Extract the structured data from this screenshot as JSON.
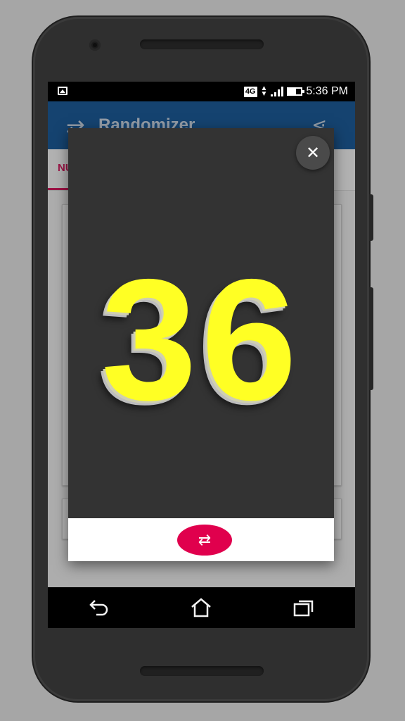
{
  "status_bar": {
    "network": "4G",
    "time": "5:36 PM"
  },
  "app_bar": {
    "title": "Randomizer"
  },
  "tabs": [
    {
      "label": "NU"
    }
  ],
  "dialog": {
    "result": "36",
    "number_color": "#ffff24",
    "background_color": "#333333",
    "close_icon": "close-icon",
    "shuffle_icon": "repeat-icon",
    "shuffle_button_color": "#e0004d"
  },
  "colors": {
    "app_bar": "#1e5e9b",
    "accent": "#d81b60"
  },
  "nav_bar": {
    "icons": [
      "back-icon",
      "home-icon",
      "recents-icon"
    ]
  }
}
